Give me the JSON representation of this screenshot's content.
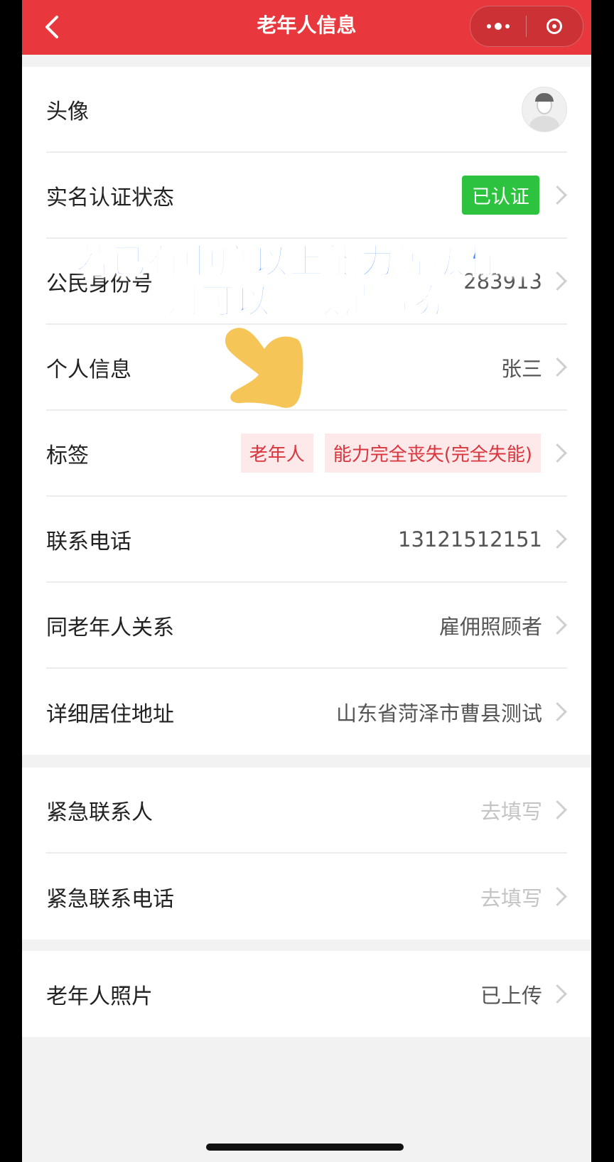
{
  "nav": {
    "title": "老年人信息",
    "back_icon": "chevron-left-icon",
    "more_icon": "more-dots-icon",
    "close_icon": "target-circle-icon",
    "bar_color": "#e8383d"
  },
  "profile": {
    "avatar_label": "头像",
    "realname_label": "实名认证状态",
    "realname_status": "已认证",
    "id_label": "公民身份号",
    "id_value_visible": "283913",
    "personal_label": "个人信息",
    "personal_value": "张三",
    "tags_label": "标签",
    "tags": [
      "老年人",
      "能力完全丧失(完全失能)"
    ],
    "phone_label": "联系电话",
    "phone_value": "13121512151",
    "relation_label": "同老年人关系",
    "relation_value": "雇佣照顾者",
    "address_label": "详细居住地址",
    "address_value": "山东省菏泽市曹县测试"
  },
  "emergency": {
    "contact_label": "紧急联系人",
    "contact_value": "去填写",
    "phone_label": "紧急联系电话",
    "phone_value": "去填写"
  },
  "photo": {
    "label": "老年人照片",
    "value": "已上传"
  },
  "overlay": {
    "line1": "若已有中度以上能力等级标签",
    "line2": "则可以领取消费券"
  },
  "colors": {
    "verified_badge": "#2ec33f",
    "tag_text": "#d9363e",
    "tag_bg": "#fde8ea",
    "overlay_text": "#2a7fff",
    "pointer": "#f5c04a"
  }
}
